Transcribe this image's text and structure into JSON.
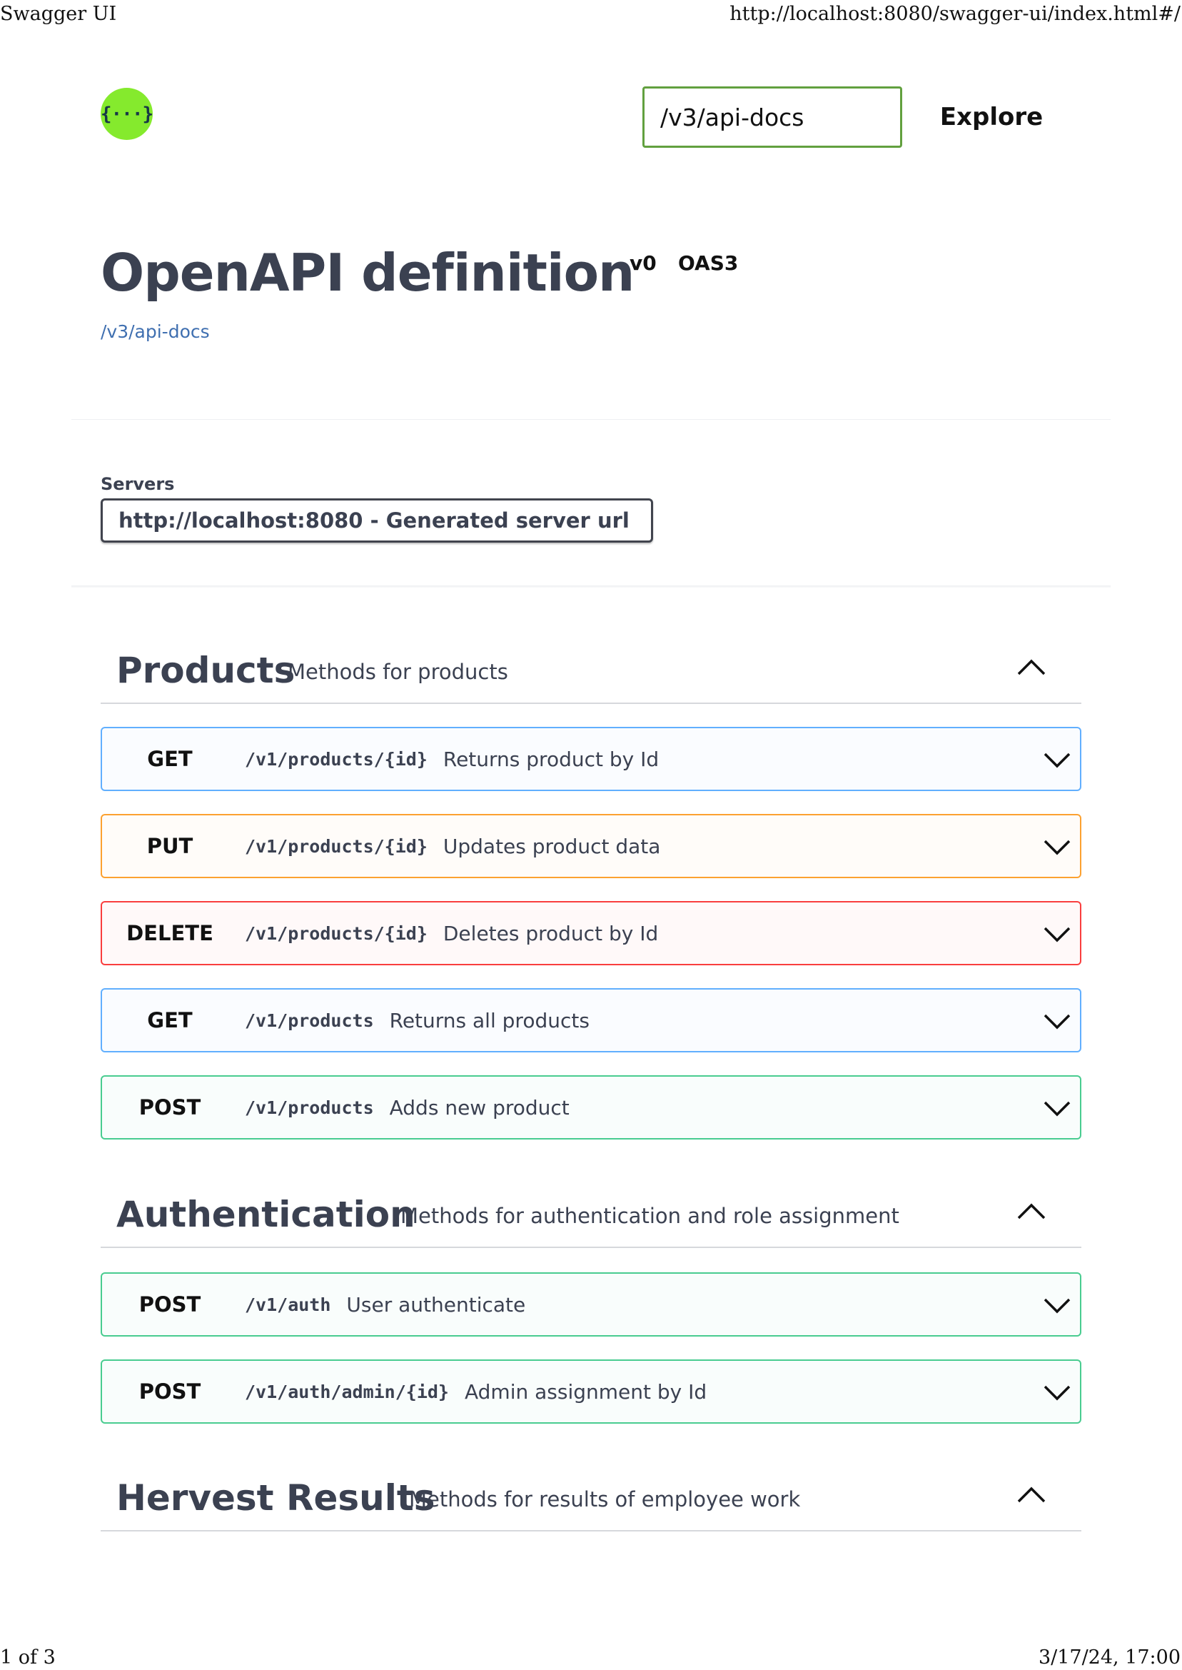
{
  "print_header": {
    "title": "Swagger UI",
    "url": "http://localhost:8080/swagger-ui/index.html#/"
  },
  "print_footer": {
    "page": "1 of 3",
    "datetime": "3/17/24, 17:00"
  },
  "topbar": {
    "logo_icon": "swagger-logo-icon",
    "logo_glyph": "{···}",
    "logo_color": "#85ea2d",
    "url_value": "/v3/api-docs",
    "explore_label": "Explore"
  },
  "info": {
    "title": "OpenAPI definition",
    "version": "v0",
    "spec": "OAS3",
    "spec_link": "/v3/api-docs"
  },
  "servers": {
    "label": "Servers",
    "selected": "http://localhost:8080 - Generated server url"
  },
  "colors": {
    "get": "#61affe",
    "put": "#fca130",
    "delete": "#f93e3e",
    "post": "#49cc90"
  },
  "tags": [
    {
      "name": "Products",
      "description": "Methods for products",
      "expanded": true,
      "operations": [
        {
          "method": "GET",
          "path": "/v1/products/{id}",
          "summary": "Returns product by Id"
        },
        {
          "method": "PUT",
          "path": "/v1/products/{id}",
          "summary": "Updates product data"
        },
        {
          "method": "DELETE",
          "path": "/v1/products/{id}",
          "summary": "Deletes product by Id"
        },
        {
          "method": "GET",
          "path": "/v1/products",
          "summary": "Returns all products"
        },
        {
          "method": "POST",
          "path": "/v1/products",
          "summary": "Adds new product"
        }
      ]
    },
    {
      "name": "Authentication",
      "description": "Methods for authentication and role assignment",
      "expanded": true,
      "operations": [
        {
          "method": "POST",
          "path": "/v1/auth",
          "summary": "User authenticate"
        },
        {
          "method": "POST",
          "path": "/v1/auth/admin/{id}",
          "summary": "Admin assignment by Id"
        }
      ]
    },
    {
      "name": "Hervest Results",
      "description": "Methods for results of employee work",
      "expanded": true,
      "operations": []
    }
  ]
}
